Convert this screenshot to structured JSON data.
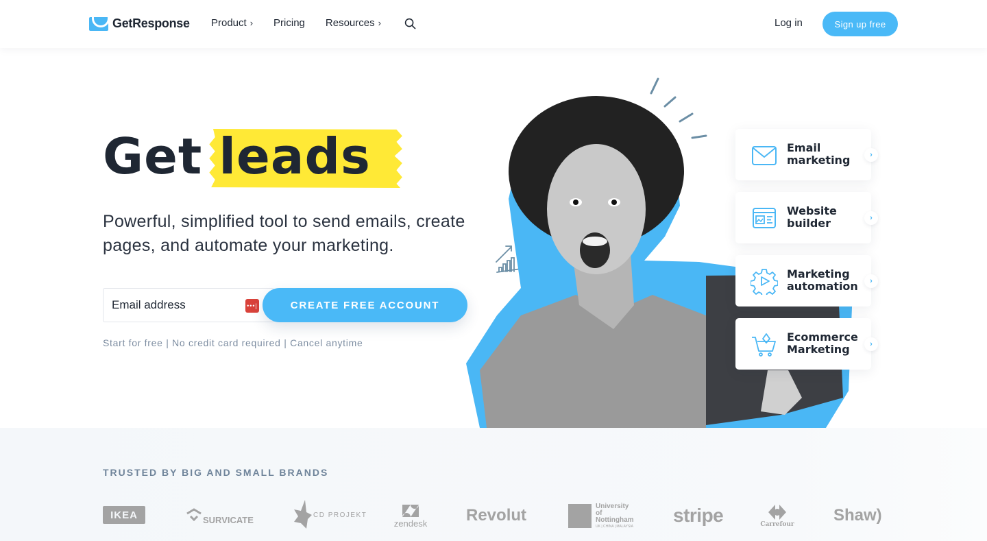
{
  "header": {
    "logo_text": "GetResponse",
    "nav": [
      {
        "label": "Product",
        "has_submenu": true
      },
      {
        "label": "Pricing",
        "has_submenu": false
      },
      {
        "label": "Resources",
        "has_submenu": true
      }
    ],
    "chevron": "›",
    "search_icon": "search-icon",
    "login_label": "Log in",
    "signup_label": "Sign up free"
  },
  "hero": {
    "title_plain": "Get",
    "title_highlight": "leads",
    "subtitle": "Powerful, simplified tool to send emails, create pages, and automate your marketing.",
    "email_placeholder": "Email address",
    "password_manager_icon": "•••|",
    "cta_label": "CREATE FREE ACCOUNT",
    "fineprint": "Start for free | No credit card required | Cancel anytime"
  },
  "features": [
    {
      "icon": "envelope-icon",
      "line1": "Email",
      "line2": "marketing"
    },
    {
      "icon": "website-builder-icon",
      "line1": "Website",
      "line2": "builder"
    },
    {
      "icon": "gear-play-icon",
      "line1": "Marketing",
      "line2": "automation"
    },
    {
      "icon": "cart-icon",
      "line1": "Ecommerce",
      "line2": "Marketing"
    }
  ],
  "feature_arrow": "›",
  "trusted": {
    "title": "TRUSTED BY BIG AND SMALL BRANDS",
    "brands": [
      "IKEA",
      "SURVICATE",
      "CD PROJEKT",
      "zendesk",
      "Revolut",
      "University of Nottingham",
      "stripe",
      "Carrefour",
      "Shaw)"
    ],
    "nottingham_sub": "UK | CHINA | MALAYSIA"
  },
  "colors": {
    "accent": "#4ab9f7",
    "highlight": "#ffe936",
    "text": "#1f2733",
    "muted": "#7d8da1"
  }
}
